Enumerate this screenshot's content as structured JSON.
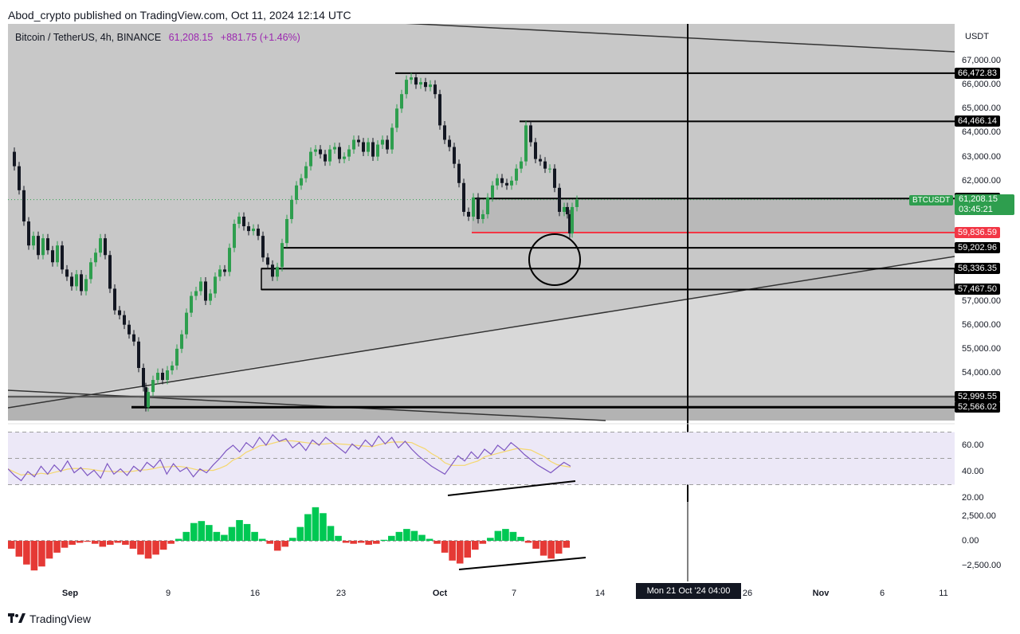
{
  "header": {
    "publisher_line": "Abod_crypto published on TradingView.com, Oct 11, 2024 12:14 UTC"
  },
  "legend": {
    "symbol": "Bitcoin / TetherUS, 4h, BINANCE",
    "last": "61,208.15",
    "change": "+881.75 (+1.46%)"
  },
  "axis": {
    "unit": "USDT"
  },
  "chart_data": {
    "type": "line",
    "title": "Bitcoin / TetherUS, 4h, BINANCE",
    "y_ticks": [
      "67,000.00",
      "66,000.00",
      "65,000.00",
      "64,000.00",
      "63,000.00",
      "62,000.00",
      "57,000.00",
      "56,000.00",
      "55,000.00",
      "54,000.00"
    ],
    "x_ticks": [
      {
        "label": "Sep",
        "bold": true
      },
      {
        "label": "9"
      },
      {
        "label": "16"
      },
      {
        "label": "23"
      },
      {
        "label": "Oct",
        "bold": true
      },
      {
        "label": "7"
      },
      {
        "label": "14"
      },
      {
        "label": "26"
      },
      {
        "label": "Nov",
        "bold": true
      },
      {
        "label": "6"
      },
      {
        "label": "11"
      }
    ],
    "price_series": [
      [
        0,
        63200
      ],
      [
        6,
        62600
      ],
      [
        12,
        61600
      ],
      [
        18,
        60300
      ],
      [
        24,
        59300
      ],
      [
        30,
        59700
      ],
      [
        36,
        58900
      ],
      [
        42,
        59600
      ],
      [
        48,
        59100
      ],
      [
        54,
        58600
      ],
      [
        60,
        59300
      ],
      [
        66,
        58300
      ],
      [
        72,
        58000
      ],
      [
        78,
        57600
      ],
      [
        84,
        58100
      ],
      [
        90,
        57400
      ],
      [
        96,
        57900
      ],
      [
        102,
        58600
      ],
      [
        108,
        59000
      ],
      [
        114,
        59600
      ],
      [
        120,
        58900
      ],
      [
        126,
        57500
      ],
      [
        132,
        56600
      ],
      [
        138,
        56400
      ],
      [
        144,
        56000
      ],
      [
        150,
        55600
      ],
      [
        156,
        55300
      ],
      [
        162,
        54200
      ],
      [
        168,
        53400
      ],
      [
        171,
        52566
      ],
      [
        174,
        53200
      ],
      [
        180,
        53700
      ],
      [
        186,
        54000
      ],
      [
        192,
        53700
      ],
      [
        198,
        54100
      ],
      [
        204,
        54300
      ],
      [
        210,
        55000
      ],
      [
        216,
        55600
      ],
      [
        222,
        56500
      ],
      [
        228,
        57200
      ],
      [
        234,
        57400
      ],
      [
        240,
        57800
      ],
      [
        246,
        57000
      ],
      [
        252,
        57300
      ],
      [
        258,
        58000
      ],
      [
        264,
        58300
      ],
      [
        270,
        58200
      ],
      [
        276,
        59200
      ],
      [
        282,
        60200
      ],
      [
        288,
        60500
      ],
      [
        294,
        60100
      ],
      [
        300,
        59900
      ],
      [
        306,
        60000
      ],
      [
        312,
        59700
      ],
      [
        318,
        58800
      ],
      [
        324,
        58500
      ],
      [
        330,
        58000
      ],
      [
        336,
        58400
      ],
      [
        342,
        59400
      ],
      [
        348,
        60400
      ],
      [
        354,
        61200
      ],
      [
        360,
        61800
      ],
      [
        366,
        62100
      ],
      [
        372,
        62600
      ],
      [
        378,
        63200
      ],
      [
        384,
        63300
      ],
      [
        390,
        63100
      ],
      [
        396,
        62800
      ],
      [
        402,
        63300
      ],
      [
        408,
        63400
      ],
      [
        414,
        62900
      ],
      [
        420,
        63000
      ],
      [
        426,
        63300
      ],
      [
        432,
        63700
      ],
      [
        438,
        63600
      ],
      [
        444,
        63200
      ],
      [
        450,
        63600
      ],
      [
        456,
        63000
      ],
      [
        462,
        63500
      ],
      [
        468,
        63700
      ],
      [
        474,
        63300
      ],
      [
        480,
        64200
      ],
      [
        486,
        65000
      ],
      [
        492,
        65600
      ],
      [
        498,
        66200
      ],
      [
        504,
        66300
      ],
      [
        510,
        66000
      ],
      [
        516,
        66100
      ],
      [
        522,
        65900
      ],
      [
        528,
        66000
      ],
      [
        534,
        65600
      ],
      [
        540,
        64300
      ],
      [
        546,
        63700
      ],
      [
        552,
        63400
      ],
      [
        558,
        62700
      ],
      [
        564,
        61900
      ],
      [
        570,
        60700
      ],
      [
        576,
        60500
      ],
      [
        582,
        61300
      ],
      [
        588,
        60400
      ],
      [
        594,
        60600
      ],
      [
        600,
        61300
      ],
      [
        606,
        61800
      ],
      [
        612,
        62100
      ],
      [
        618,
        61900
      ],
      [
        624,
        61800
      ],
      [
        630,
        62000
      ],
      [
        636,
        62500
      ],
      [
        642,
        62800
      ],
      [
        648,
        64300
      ],
      [
        654,
        63600
      ],
      [
        660,
        62900
      ],
      [
        666,
        62800
      ],
      [
        672,
        62500
      ],
      [
        678,
        62500
      ],
      [
        684,
        61700
      ],
      [
        690,
        60700
      ],
      [
        696,
        60900
      ],
      [
        700,
        60600
      ],
      [
        703,
        59800
      ],
      [
        706,
        60900
      ],
      [
        712,
        61200
      ]
    ],
    "levels": [
      "66,472.83",
      "64,466.14",
      "61,256.22",
      "59,836.59",
      "59,202.96",
      "58,336.35",
      "57,467.50",
      "52,999.55",
      "52,566.02"
    ],
    "last_price": {
      "symbol": "BTCUSDT",
      "price": "61,208.15",
      "countdown": "03:45:21"
    },
    "rsi": {
      "ticks": [
        "60.00",
        "40.00",
        "20.00"
      ],
      "values": [
        42,
        37,
        33,
        40,
        36,
        44,
        38,
        45,
        40,
        48,
        39,
        43,
        37,
        41,
        35,
        46,
        38,
        42,
        37,
        44,
        40,
        47,
        43,
        49,
        38,
        46,
        40,
        43,
        36,
        42,
        39,
        45,
        50,
        56,
        60,
        55,
        62,
        58,
        66,
        60,
        68,
        63,
        65,
        58,
        62,
        56,
        64,
        60,
        66,
        62,
        58,
        54,
        61,
        57,
        64,
        59,
        67,
        61,
        66,
        58,
        63,
        57,
        52,
        48,
        44,
        41,
        38,
        45,
        52,
        48,
        55,
        50,
        57,
        53,
        60,
        56,
        62,
        58,
        53,
        49,
        45,
        42,
        39,
        43,
        47,
        44
      ]
    },
    "macd": {
      "ticks": [
        "2,500.00",
        "0.00",
        "−2,500.00"
      ],
      "values": [
        -800,
        -1600,
        -2400,
        -3000,
        -2600,
        -1800,
        -1200,
        -700,
        -400,
        -200,
        -100,
        -300,
        -600,
        -400,
        -200,
        -400,
        -800,
        -1400,
        -1800,
        -1400,
        -900,
        -300,
        200,
        900,
        1800,
        2000,
        1600,
        900,
        600,
        1400,
        2100,
        1700,
        900,
        200,
        -300,
        -1000,
        -600,
        300,
        1400,
        2700,
        3400,
        2800,
        1500,
        500,
        -200,
        -300,
        -200,
        -400,
        -300,
        100,
        500,
        900,
        1200,
        1000,
        600,
        200,
        -300,
        -1200,
        -2000,
        -2300,
        -1700,
        -900,
        -300,
        300,
        1000,
        1200,
        900,
        400,
        -200,
        -800,
        -1500,
        -1800,
        -1300,
        -700
      ]
    },
    "crosshair_label": "Mon 21 Oct '24   04:00"
  },
  "colors": {
    "up": "#26a69a",
    "down": "#131722",
    "macd_up": "#00c853",
    "macd_down": "#e53935",
    "rsi": "#7e57c2",
    "rsi_ma": "#f5d76e",
    "level_red": "#f23645"
  },
  "brand": {
    "logo_text": "TradingView"
  }
}
